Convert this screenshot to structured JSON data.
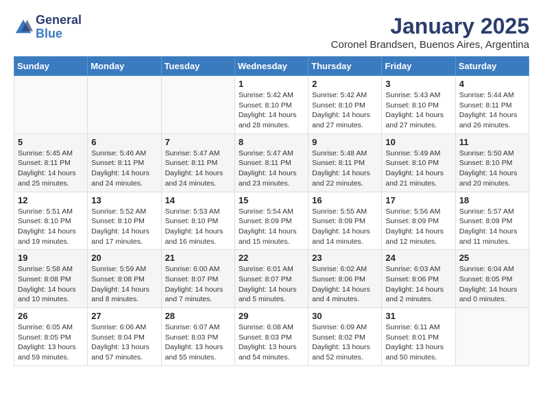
{
  "header": {
    "logo_general": "General",
    "logo_blue": "Blue",
    "month": "January 2025",
    "location": "Coronel Brandsen, Buenos Aires, Argentina"
  },
  "weekdays": [
    "Sunday",
    "Monday",
    "Tuesday",
    "Wednesday",
    "Thursday",
    "Friday",
    "Saturday"
  ],
  "weeks": [
    [
      {
        "day": "",
        "content": ""
      },
      {
        "day": "",
        "content": ""
      },
      {
        "day": "",
        "content": ""
      },
      {
        "day": "1",
        "content": "Sunrise: 5:42 AM\nSunset: 8:10 PM\nDaylight: 14 hours and 28 minutes."
      },
      {
        "day": "2",
        "content": "Sunrise: 5:42 AM\nSunset: 8:10 PM\nDaylight: 14 hours and 27 minutes."
      },
      {
        "day": "3",
        "content": "Sunrise: 5:43 AM\nSunset: 8:10 PM\nDaylight: 14 hours and 27 minutes."
      },
      {
        "day": "4",
        "content": "Sunrise: 5:44 AM\nSunset: 8:11 PM\nDaylight: 14 hours and 26 minutes."
      }
    ],
    [
      {
        "day": "5",
        "content": "Sunrise: 5:45 AM\nSunset: 8:11 PM\nDaylight: 14 hours and 25 minutes."
      },
      {
        "day": "6",
        "content": "Sunrise: 5:46 AM\nSunset: 8:11 PM\nDaylight: 14 hours and 24 minutes."
      },
      {
        "day": "7",
        "content": "Sunrise: 5:47 AM\nSunset: 8:11 PM\nDaylight: 14 hours and 24 minutes."
      },
      {
        "day": "8",
        "content": "Sunrise: 5:47 AM\nSunset: 8:11 PM\nDaylight: 14 hours and 23 minutes."
      },
      {
        "day": "9",
        "content": "Sunrise: 5:48 AM\nSunset: 8:11 PM\nDaylight: 14 hours and 22 minutes."
      },
      {
        "day": "10",
        "content": "Sunrise: 5:49 AM\nSunset: 8:10 PM\nDaylight: 14 hours and 21 minutes."
      },
      {
        "day": "11",
        "content": "Sunrise: 5:50 AM\nSunset: 8:10 PM\nDaylight: 14 hours and 20 minutes."
      }
    ],
    [
      {
        "day": "12",
        "content": "Sunrise: 5:51 AM\nSunset: 8:10 PM\nDaylight: 14 hours and 19 minutes."
      },
      {
        "day": "13",
        "content": "Sunrise: 5:52 AM\nSunset: 8:10 PM\nDaylight: 14 hours and 17 minutes."
      },
      {
        "day": "14",
        "content": "Sunrise: 5:53 AM\nSunset: 8:10 PM\nDaylight: 14 hours and 16 minutes."
      },
      {
        "day": "15",
        "content": "Sunrise: 5:54 AM\nSunset: 8:09 PM\nDaylight: 14 hours and 15 minutes."
      },
      {
        "day": "16",
        "content": "Sunrise: 5:55 AM\nSunset: 8:09 PM\nDaylight: 14 hours and 14 minutes."
      },
      {
        "day": "17",
        "content": "Sunrise: 5:56 AM\nSunset: 8:09 PM\nDaylight: 14 hours and 12 minutes."
      },
      {
        "day": "18",
        "content": "Sunrise: 5:57 AM\nSunset: 8:09 PM\nDaylight: 14 hours and 11 minutes."
      }
    ],
    [
      {
        "day": "19",
        "content": "Sunrise: 5:58 AM\nSunset: 8:08 PM\nDaylight: 14 hours and 10 minutes."
      },
      {
        "day": "20",
        "content": "Sunrise: 5:59 AM\nSunset: 8:08 PM\nDaylight: 14 hours and 8 minutes."
      },
      {
        "day": "21",
        "content": "Sunrise: 6:00 AM\nSunset: 8:07 PM\nDaylight: 14 hours and 7 minutes."
      },
      {
        "day": "22",
        "content": "Sunrise: 6:01 AM\nSunset: 8:07 PM\nDaylight: 14 hours and 5 minutes."
      },
      {
        "day": "23",
        "content": "Sunrise: 6:02 AM\nSunset: 8:06 PM\nDaylight: 14 hours and 4 minutes."
      },
      {
        "day": "24",
        "content": "Sunrise: 6:03 AM\nSunset: 8:06 PM\nDaylight: 14 hours and 2 minutes."
      },
      {
        "day": "25",
        "content": "Sunrise: 6:04 AM\nSunset: 8:05 PM\nDaylight: 14 hours and 0 minutes."
      }
    ],
    [
      {
        "day": "26",
        "content": "Sunrise: 6:05 AM\nSunset: 8:05 PM\nDaylight: 13 hours and 59 minutes."
      },
      {
        "day": "27",
        "content": "Sunrise: 6:06 AM\nSunset: 8:04 PM\nDaylight: 13 hours and 57 minutes."
      },
      {
        "day": "28",
        "content": "Sunrise: 6:07 AM\nSunset: 8:03 PM\nDaylight: 13 hours and 55 minutes."
      },
      {
        "day": "29",
        "content": "Sunrise: 6:08 AM\nSunset: 8:03 PM\nDaylight: 13 hours and 54 minutes."
      },
      {
        "day": "30",
        "content": "Sunrise: 6:09 AM\nSunset: 8:02 PM\nDaylight: 13 hours and 52 minutes."
      },
      {
        "day": "31",
        "content": "Sunrise: 6:11 AM\nSunset: 8:01 PM\nDaylight: 13 hours and 50 minutes."
      },
      {
        "day": "",
        "content": ""
      }
    ]
  ]
}
